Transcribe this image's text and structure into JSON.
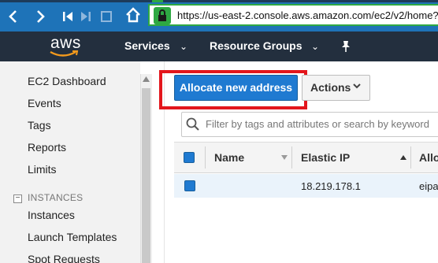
{
  "browser": {
    "url": "https://us-east-2.console.aws.amazon.com/ec2/v2/home?r"
  },
  "header": {
    "logo": "aws",
    "services_label": "Services",
    "resource_groups_label": "Resource Groups",
    "chevron": "⌄"
  },
  "sidebar": {
    "items": [
      {
        "label": "EC2 Dashboard"
      },
      {
        "label": "Events"
      },
      {
        "label": "Tags"
      },
      {
        "label": "Reports"
      },
      {
        "label": "Limits"
      }
    ],
    "section_toggle": "−",
    "section": "INSTANCES",
    "section_items": [
      {
        "label": "Instances"
      },
      {
        "label": "Launch Templates"
      },
      {
        "label": "Spot Requests"
      }
    ]
  },
  "toolbar": {
    "allocate_label": "Allocate new address",
    "actions_label": "Actions"
  },
  "search": {
    "placeholder": "Filter by tags and attributes or search by keyword"
  },
  "table": {
    "columns": [
      "Name",
      "Elastic IP",
      "Allo"
    ],
    "rows": [
      {
        "name": "",
        "elastic_ip": "18.219.178.1",
        "allocation": "eipa"
      }
    ]
  },
  "colors": {
    "browser_bar": "#1e73b8",
    "aws_header": "#232f3e",
    "primary_button": "#1f7ad1",
    "highlight_box": "#e3161c",
    "secure_green": "#2ea843"
  },
  "icons": [
    "back-arrow-icon",
    "forward-arrow-icon",
    "skip-back-icon",
    "skip-forward-icon",
    "home-icon",
    "lock-icon",
    "pin-icon",
    "caret-down-icon",
    "search-icon",
    "sort-caret-icon"
  ]
}
